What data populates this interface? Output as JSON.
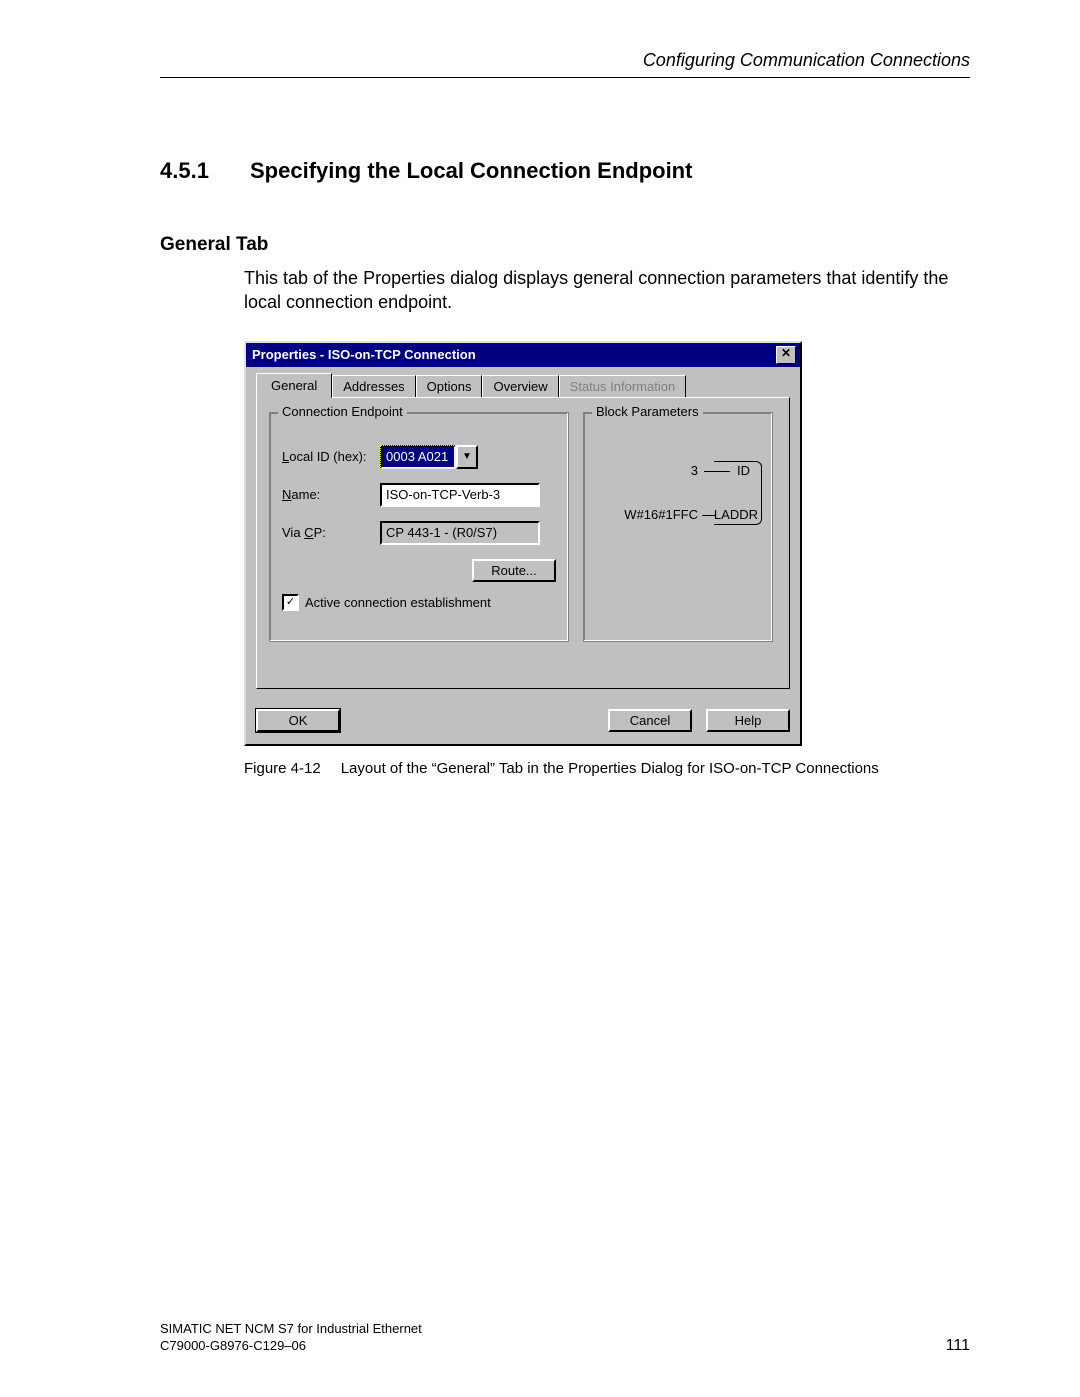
{
  "header": {
    "running": "Configuring Communication Connections"
  },
  "section": {
    "number": "4.5.1",
    "title": "Specifying the Local Connection Endpoint"
  },
  "subsection": {
    "title": "General Tab"
  },
  "paragraph": "This tab of the Properties dialog displays general connection parameters that identify the local connection endpoint.",
  "dialog": {
    "title": "Properties - ISO-on-TCP Connection",
    "tabs": {
      "general": "General",
      "addresses": "Addresses",
      "options": "Options",
      "overview": "Overview",
      "status": "Status Information"
    },
    "group_endpoint": {
      "legend": "Connection Endpoint",
      "local_id_label_pre": "L",
      "local_id_label_post": "ocal ID (hex):",
      "local_id_value": "0003 A021",
      "name_label_pre": "N",
      "name_label_post": "ame:",
      "name_value": "ISO-on-TCP-Verb-3",
      "viacp_label_pre": "Via ",
      "viacp_label_u": "C",
      "viacp_label_post": "P:",
      "viacp_value": "CP 443-1 - (R0/S7)",
      "route_btn_pre": "R",
      "route_btn_post": "oute...",
      "checkbox_label_pre": "Active connection ",
      "checkbox_label_u": "e",
      "checkbox_label_post": "stablishment",
      "checkbox_checked": "✓"
    },
    "group_block": {
      "legend": "Block Parameters",
      "id_value": "3",
      "id_label": "ID",
      "laddr_value": "W#16#1FFC",
      "laddr_label": "LADDR"
    },
    "buttons": {
      "ok": "OK",
      "cancel": "Cancel",
      "help": "Help"
    }
  },
  "caption": {
    "fig": "Figure 4-12",
    "text": "Layout of the “General” Tab in the Properties Dialog for ISO-on-TCP Connections"
  },
  "footer": {
    "line1": "SIMATIC NET NCM S7 for Industrial Ethernet",
    "line2": "C79000-G8976-C129–06",
    "page": "111"
  }
}
